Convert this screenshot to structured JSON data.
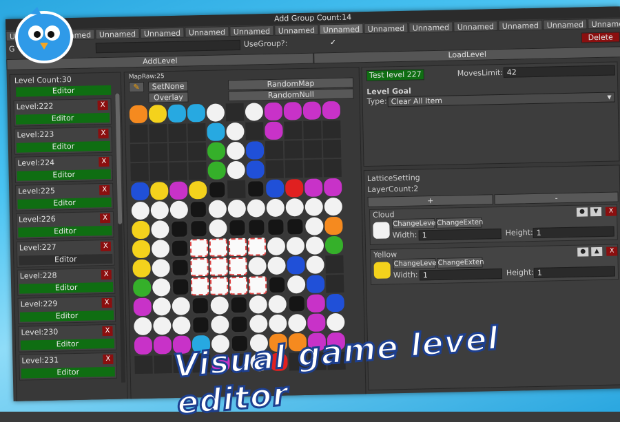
{
  "window": {
    "title": "Add Group  Count:14"
  },
  "tabs": [
    "Unnamed",
    "Unnamed",
    "Unnamed",
    "Unnamed",
    "Unnamed",
    "Unnamed",
    "Unnamed",
    "Unnamed",
    "Unnamed",
    "Unnamed",
    "Unnamed",
    "Unnamed",
    "Unnamed",
    "Unnamed"
  ],
  "active_tab_index": 7,
  "group": {
    "label": "G",
    "use_group_label": "UseGroup?:",
    "use_group_checked": true,
    "delete_label": "Delete",
    "checkmark": "✓"
  },
  "actions": {
    "add_level": "AddLevel",
    "load_level": "LoadLevel"
  },
  "levels": {
    "count_label": "Level Count:30",
    "top_editor": "Editor",
    "items": [
      {
        "name": "Level:222",
        "editor": "Editor",
        "x": "X"
      },
      {
        "name": "Level:223",
        "editor": "Editor",
        "x": "X"
      },
      {
        "name": "Level:224",
        "editor": "Editor",
        "x": "X"
      },
      {
        "name": "Level:225",
        "editor": "Editor",
        "x": "X"
      },
      {
        "name": "Level:226",
        "editor": "Editor",
        "x": "X"
      },
      {
        "name": "Level:227",
        "editor": "Editor",
        "x": "X"
      },
      {
        "name": "Level:228",
        "editor": "Editor",
        "x": "X"
      },
      {
        "name": "Level:229",
        "editor": "Editor",
        "x": "X"
      },
      {
        "name": "Level:230",
        "editor": "Editor",
        "x": "X"
      },
      {
        "name": "Level:231",
        "editor": "Editor",
        "x": "X"
      }
    ],
    "selected_index": 5
  },
  "map": {
    "raw_label": "MapRaw:25",
    "set_none": "SetNone",
    "overlay": "Overlay",
    "random_map": "RandomMap",
    "random_null": "RandomNull",
    "rows": [
      "oyccw.wmmmm",
      "....cw.m...",
      "....gwb....",
      "....gwb....",
      "bymyk.kbrmm",
      "wwwkwwwwwww",
      "ywkkwkkkkwo",
      "ywksssswwwg",
      "ywkssswwbw.",
      "gwksssskwb.",
      "mwwkwkwwkmb",
      "wwwkwkwwwmw",
      "mmmcwkwoomm",
      "....m.wr..."
    ]
  },
  "test": {
    "label": "Test level 227",
    "moves_label": "MovesLimit:",
    "moves_value": "42"
  },
  "goal": {
    "title": "Level Goal",
    "type_label": "Type:",
    "type_value": "Clear All Item"
  },
  "lattice": {
    "title": "LatticeSetting",
    "layer_count": "LayerCount:2",
    "plus": "+",
    "minus": "-",
    "layers": [
      {
        "name": "Cloud",
        "change_level": "ChangeLeve",
        "change_extent": "ChangeExten",
        "width_label": "Width:",
        "width": "1",
        "height_label": "Height:",
        "height": "1",
        "arrow": "▼",
        "x": "X",
        "dot": "●"
      },
      {
        "name": "Yellow",
        "change_level": "ChangeLeve",
        "change_extent": "ChangeExten",
        "width_label": "Width:",
        "width": "1",
        "height_label": "Height:",
        "height": "1",
        "arrow": "▲",
        "x": "X",
        "dot": "●"
      }
    ]
  },
  "caption": "Visual game level editor",
  "colors": {
    "accent_green": "#0f6e12",
    "delete_red": "#8b0f0f",
    "bg_blue": "#2aa7e0"
  }
}
